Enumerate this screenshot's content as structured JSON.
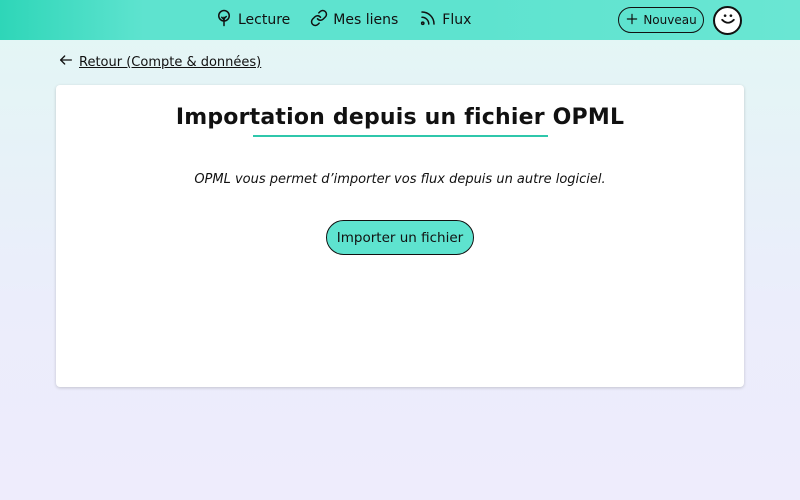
{
  "nav": {
    "items": [
      {
        "label": "Lecture",
        "icon": "tree-icon"
      },
      {
        "label": "Mes liens",
        "icon": "link-icon"
      },
      {
        "label": "Flux",
        "icon": "rss-icon"
      }
    ],
    "new_label": "Nouveau"
  },
  "back": {
    "label": "Retour (Compte & données)"
  },
  "card": {
    "title": "Importation depuis un fichier OPML",
    "description": "OPML vous permet d’importer vos flux depuis un autre logiciel.",
    "import_label": "Importer un fichier"
  },
  "colors": {
    "accent": "#5ee3cf",
    "accent_dark": "#2fc7ab",
    "background_top": "#e2f7f4",
    "background_bottom": "#eeecfc"
  }
}
